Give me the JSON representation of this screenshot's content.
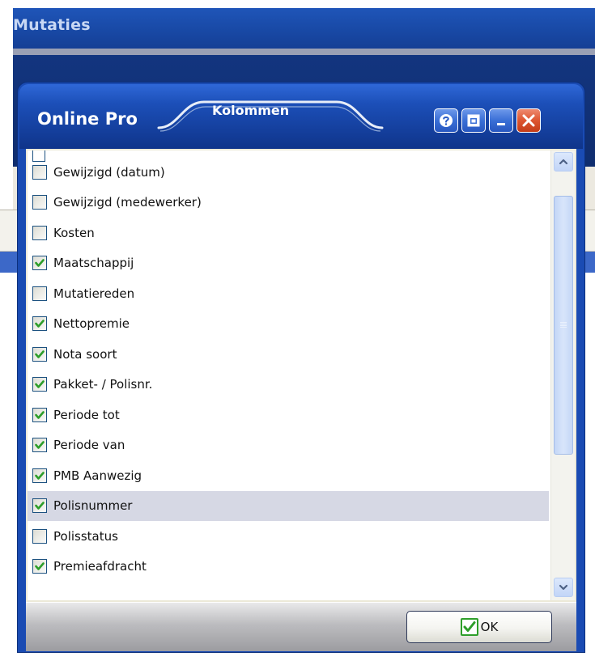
{
  "background_app": {
    "title": "Mutaties"
  },
  "dialog": {
    "title": "Online Pro",
    "tab_label": "Kolommen",
    "buttons": {
      "help_icon": "help-icon",
      "restore_icon": "restore-icon",
      "minimize_icon": "minimize-icon",
      "close_icon": "close-icon"
    }
  },
  "column_list": {
    "items": [
      {
        "label": "Gewijzigd (datum)",
        "checked": false
      },
      {
        "label": "Gewijzigd (medewerker)",
        "checked": false
      },
      {
        "label": "Kosten",
        "checked": false
      },
      {
        "label": "Maatschappij",
        "checked": true
      },
      {
        "label": "Mutatiereden",
        "checked": false
      },
      {
        "label": "Nettopremie",
        "checked": true
      },
      {
        "label": "Nota soort",
        "checked": true
      },
      {
        "label": "Pakket- / Polisnr.",
        "checked": true
      },
      {
        "label": "Periode tot",
        "checked": true
      },
      {
        "label": "Periode van",
        "checked": true
      },
      {
        "label": "PMB Aanwezig",
        "checked": true
      },
      {
        "label": "Polisnummer",
        "checked": true,
        "selected": true
      },
      {
        "label": "Polisstatus",
        "checked": false
      },
      {
        "label": "Premieafdracht",
        "checked": true
      }
    ]
  },
  "footer": {
    "ok_label": "OK"
  },
  "colors": {
    "titlebar_blue": "#1c4fb8",
    "close_red": "#dd5530",
    "check_green": "#2e9e2a",
    "selected_row": "#d6d8e4"
  }
}
